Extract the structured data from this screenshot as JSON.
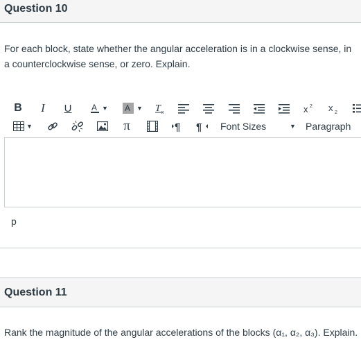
{
  "question10": {
    "title": "Question 10",
    "text": "For each block, state whether the angular acceleration is in a clockwise sense, in a counterclockwise sense, or zero. Explain."
  },
  "toolbar": {
    "bold": "B",
    "italic": "I",
    "underline": "U",
    "font_sizes_label": "Font Sizes",
    "paragraph_label": "Paragraph",
    "icons": [
      "bold-icon",
      "italic-icon",
      "underline-icon",
      "text-color-icon",
      "background-color-icon",
      "clear-formatting-icon",
      "align-left-icon",
      "align-center-icon",
      "align-right-icon",
      "outdent-icon",
      "indent-icon",
      "superscript-icon",
      "subscript-icon",
      "list-icon",
      "table-icon",
      "link-icon",
      "unlink-icon",
      "image-icon",
      "math-pi-icon",
      "media-icon",
      "ltr-paragraph-icon",
      "rtl-paragraph-icon"
    ]
  },
  "editor": {
    "status_path": "p"
  },
  "question11": {
    "title": "Question 11",
    "text": "Rank the magnitude of the angular accelerations of the blocks (α₁, α₂, α₃). Explain."
  },
  "colors": {
    "header_bg": "#f5f5f5",
    "border": "#c7cdd1",
    "text": "#2d3b45",
    "highlight_chip": "#a5a5a5"
  }
}
